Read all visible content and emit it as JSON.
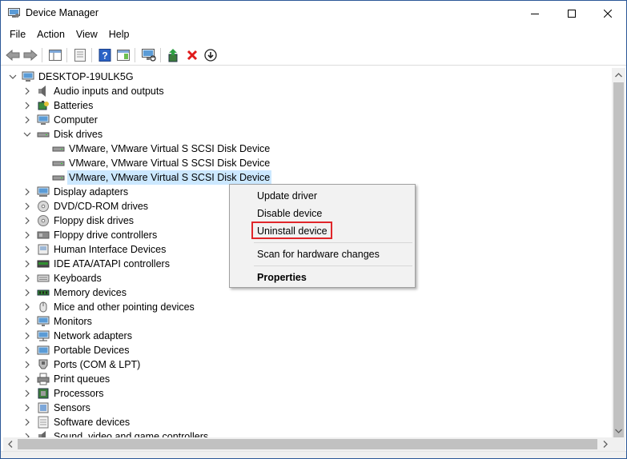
{
  "window": {
    "title": "Device Manager"
  },
  "menu": [
    "File",
    "Action",
    "View",
    "Help"
  ],
  "toolbar": {
    "buttons": [
      "back-arrow-icon",
      "forward-arrow-icon",
      "show-hide-console-tree-icon",
      "properties-icon",
      "help-icon",
      "action-pane-icon",
      "scan-hardware-icon",
      "update-driver-icon",
      "uninstall-x-icon",
      "disable-device-icon"
    ]
  },
  "tree": {
    "root": "DESKTOP-19ULK5G",
    "nodes": [
      {
        "label": "Audio inputs and outputs",
        "icon": "speaker-icon",
        "state": "collapsed"
      },
      {
        "label": "Batteries",
        "icon": "battery-icon",
        "state": "collapsed"
      },
      {
        "label": "Computer",
        "icon": "computer-icon",
        "state": "collapsed"
      },
      {
        "label": "Disk drives",
        "icon": "disk-drive-icon",
        "state": "expanded",
        "children": [
          {
            "label": "VMware, VMware Virtual S SCSI Disk Device"
          },
          {
            "label": "VMware, VMware Virtual S SCSI Disk Device"
          },
          {
            "label": "VMware, VMware Virtual S SCSI Disk Device",
            "selected": true
          }
        ]
      },
      {
        "label": "Display adapters",
        "icon": "display-adapter-icon",
        "state": "collapsed"
      },
      {
        "label": "DVD/CD-ROM drives",
        "icon": "dvd-icon",
        "state": "collapsed"
      },
      {
        "label": "Floppy disk drives",
        "icon": "floppy-disk-icon",
        "state": "collapsed"
      },
      {
        "label": "Floppy drive controllers",
        "icon": "floppy-controller-icon",
        "state": "collapsed"
      },
      {
        "label": "Human Interface Devices",
        "icon": "hid-icon",
        "state": "collapsed"
      },
      {
        "label": "IDE ATA/ATAPI controllers",
        "icon": "ide-controller-icon",
        "state": "collapsed"
      },
      {
        "label": "Keyboards",
        "icon": "keyboard-icon",
        "state": "collapsed"
      },
      {
        "label": "Memory devices",
        "icon": "memory-icon",
        "state": "collapsed"
      },
      {
        "label": "Mice and other pointing devices",
        "icon": "mouse-icon",
        "state": "collapsed"
      },
      {
        "label": "Monitors",
        "icon": "monitor-icon",
        "state": "collapsed"
      },
      {
        "label": "Network adapters",
        "icon": "network-adapter-icon",
        "state": "collapsed"
      },
      {
        "label": "Portable Devices",
        "icon": "portable-device-icon",
        "state": "collapsed"
      },
      {
        "label": "Ports (COM & LPT)",
        "icon": "port-icon",
        "state": "collapsed"
      },
      {
        "label": "Print queues",
        "icon": "printer-icon",
        "state": "collapsed"
      },
      {
        "label": "Processors",
        "icon": "processor-icon",
        "state": "collapsed"
      },
      {
        "label": "Sensors",
        "icon": "sensor-icon",
        "state": "collapsed"
      },
      {
        "label": "Software devices",
        "icon": "software-device-icon",
        "state": "collapsed"
      },
      {
        "label": "Sound, video and game controllers",
        "icon": "sound-controller-icon",
        "state": "collapsed"
      }
    ]
  },
  "context_menu": {
    "items": [
      "Update driver",
      "Disable device",
      "Uninstall device",
      "Scan for hardware changes",
      "Properties"
    ],
    "highlighted": "Uninstall device",
    "highlight_color": "#e0262a"
  },
  "colors": {
    "selection": "#cce8ff",
    "window_border": "#2b5797"
  }
}
